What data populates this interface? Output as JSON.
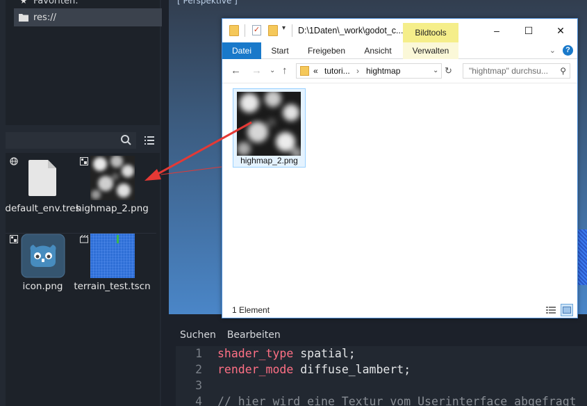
{
  "godot": {
    "favorites_label": "Favoriten:",
    "res_label": "res://",
    "files": [
      {
        "name": "default_env.tres"
      },
      {
        "name": "highmap_2.png"
      },
      {
        "name": "icon.png"
      },
      {
        "name": "terrain_test.tscn"
      }
    ],
    "viewport_label": "[ Perspektive ]",
    "editor_menu": [
      "Suchen",
      "Bearbeiten"
    ],
    "code": [
      {
        "num": "1",
        "kw": "shader_type",
        "rest": " spatial;"
      },
      {
        "num": "2",
        "kw": "render_mode",
        "rest": " diffuse_lambert;"
      },
      {
        "num": "3",
        "kw": "",
        "rest": ""
      },
      {
        "num": "4",
        "comment": "// hier wird eine Textur vom Userinterface abgefragt"
      }
    ],
    "colors": {
      "keyword": "#ff7085",
      "accent": "#3b424d"
    }
  },
  "explorer": {
    "title": "D:\\1Daten\\_work\\godot_c...",
    "context_tab": "Bildtools",
    "ribbon_tabs": [
      "Datei",
      "Start",
      "Freigeben",
      "Ansicht",
      "Verwalten"
    ],
    "address_prefix": "«",
    "address_crumbs": [
      "tutori...",
      "hightmap"
    ],
    "search_placeholder": "\"hightmap\" durchsu...",
    "file_name": "highmap_2.png",
    "status": "1 Element",
    "window_buttons": {
      "minimize": "–",
      "maximize": "☐",
      "close": "✕"
    },
    "colors": {
      "file_tab": "#1979ca",
      "context_tab": "#f5ee8a",
      "selection": "#e5f3ff"
    }
  },
  "annotation": {
    "arrow_color": "#e53935"
  }
}
